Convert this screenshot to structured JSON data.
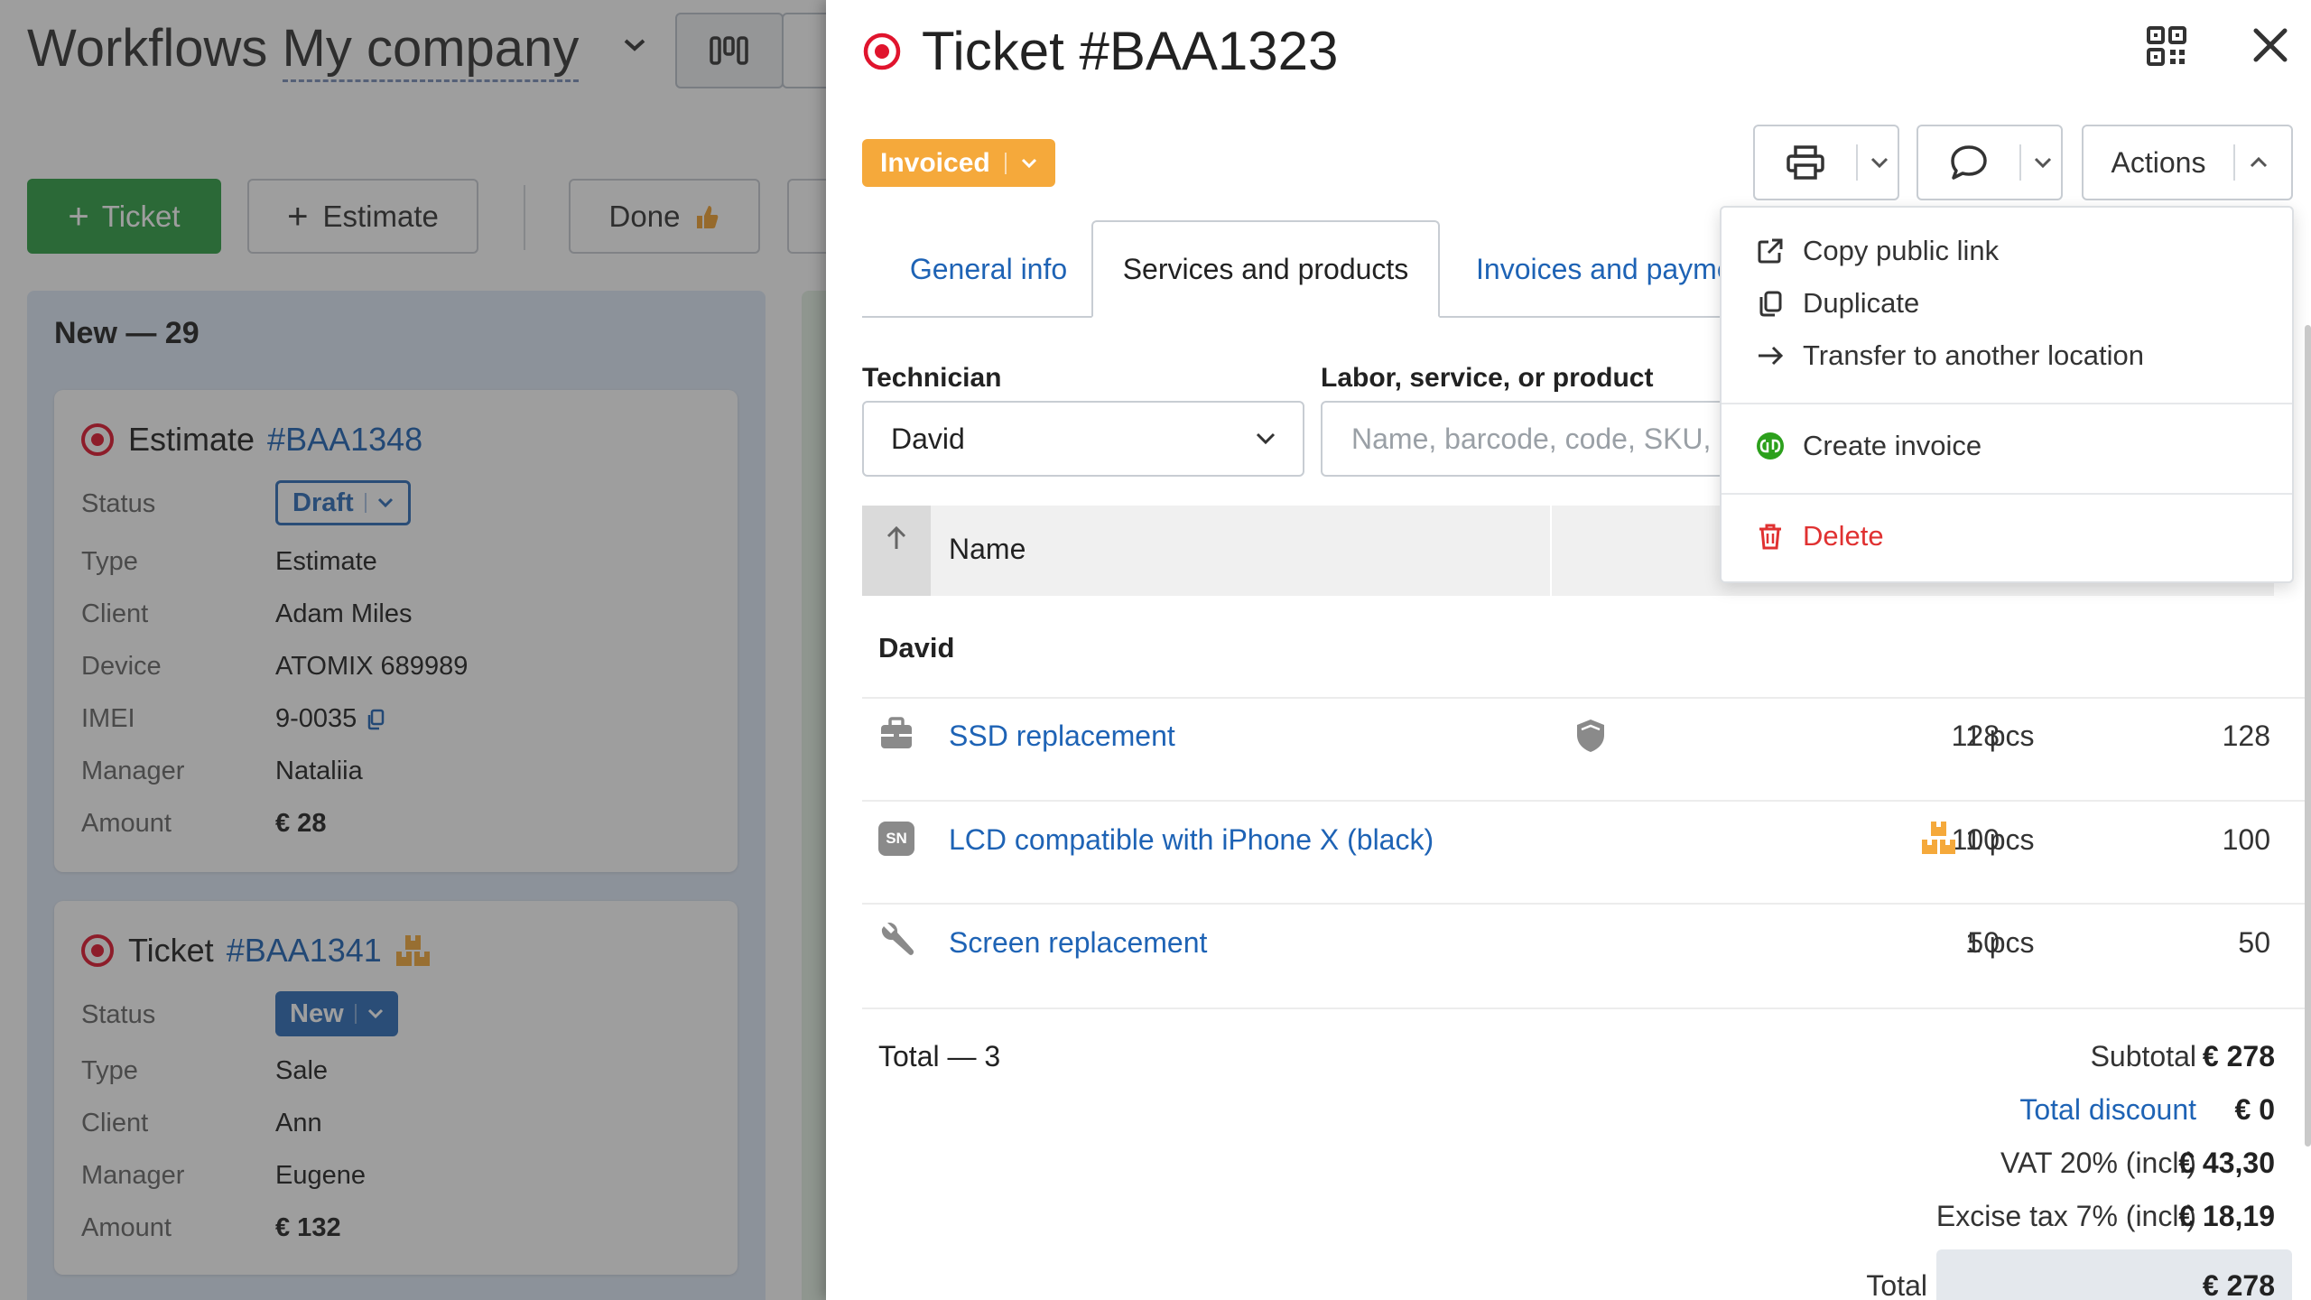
{
  "background": {
    "title": "Workflows",
    "company": "My company",
    "buttons": {
      "ticket": "Ticket",
      "estimate": "Estimate",
      "done": "Done"
    },
    "column": {
      "header": "New — 29"
    },
    "cards": [
      {
        "kind": "Estimate",
        "number": "#BAA1348",
        "labels": [
          "Status",
          "Type",
          "Client",
          "Device",
          "IMEI",
          "Manager",
          "Amount"
        ],
        "status": "Draft",
        "type": "Estimate",
        "client": "Adam Miles",
        "device": "ATOMIX 689989",
        "imei": "9-0035",
        "manager": "Nataliia",
        "amount": "€ 28"
      },
      {
        "kind": "Ticket",
        "number": "#BAA1341",
        "labels": [
          "Status",
          "Type",
          "Client",
          "Manager",
          "Amount"
        ],
        "status": "New",
        "type": "Sale",
        "client": "Ann",
        "manager": "Eugene",
        "amount": "€ 132"
      }
    ]
  },
  "drawer": {
    "title": "Ticket #BAA1323",
    "status": "Invoiced",
    "status_color": "#f5a93b",
    "actions_label": "Actions",
    "tabs": [
      {
        "label": "General info"
      },
      {
        "label": "Services and products"
      },
      {
        "label": "Invoices and payme"
      }
    ],
    "technician_label": "Technician",
    "technician_value": "David",
    "product_label": "Labor, service, or product",
    "product_placeholder": "Name, barcode, code, SKU,",
    "table_header": {
      "name": "Name"
    },
    "group": "David",
    "rows": [
      {
        "icon": "briefcase-icon",
        "name": "SSD replacement",
        "price": "128",
        "qty": "1 pcs",
        "total": "128"
      },
      {
        "icon": "sn-badge-icon",
        "name": "LCD compatible with iPhone X (black)",
        "price": "100",
        "qty": "1 pcs",
        "total": "100"
      },
      {
        "icon": "wrench-icon",
        "name": "Screen replacement",
        "price": "50",
        "qty": "1 pcs",
        "total": "50"
      }
    ],
    "total_count": "Total — 3",
    "summary": [
      {
        "label": "Subtotal",
        "value": "€ 278"
      },
      {
        "label": "Total discount",
        "value": "€ 0"
      },
      {
        "label": "VAT 20% (incl.)",
        "value": "€ 43,30"
      },
      {
        "label": "Excise tax 7% (incl.)",
        "value": "€ 18,19"
      },
      {
        "label": "Total",
        "value": "€ 278"
      }
    ]
  },
  "actions_menu": {
    "items": [
      {
        "label": "Copy public link",
        "icon": "external-link-icon"
      },
      {
        "label": "Duplicate",
        "icon": "copy-icon"
      },
      {
        "label": "Transfer to another location",
        "icon": "arrow-right-icon"
      },
      {
        "label": "Create invoice",
        "icon": "quickbooks-icon"
      },
      {
        "label": "Delete",
        "icon": "trash-icon",
        "color": "#e03131"
      }
    ]
  },
  "colors": {
    "link": "#1e63b5",
    "primary_green": "#2f9e44",
    "danger": "#e03131",
    "target_red": "#e0142d",
    "new_badge": "#2c6cb8"
  }
}
